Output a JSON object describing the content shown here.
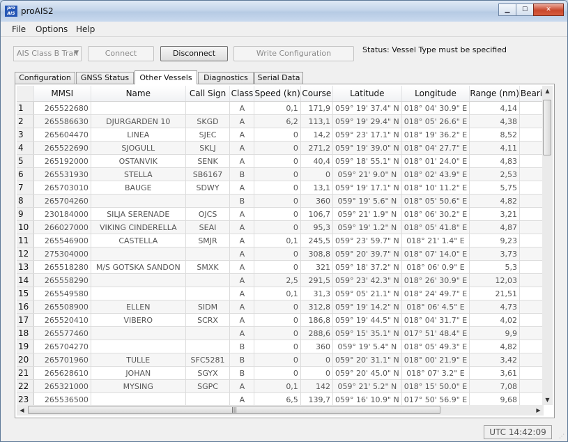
{
  "window": {
    "title": "proAIS2",
    "icon_text": "pro AIS"
  },
  "menu": [
    "File",
    "Options",
    "Help"
  ],
  "toolbar": {
    "device_select": "AIS Class B Tran",
    "connect_label": "Connect",
    "disconnect_label": "Disconnect",
    "write_config_label": "Write Configuration",
    "status_text": "Status: Vessel Type must be specified"
  },
  "tabs": [
    "Configuration",
    "GNSS Status",
    "Other Vessels",
    "Diagnostics",
    "Serial Data"
  ],
  "selected_tab": "Other Vessels",
  "table": {
    "columns": [
      "",
      "MMSI",
      "Name",
      "Call Sign",
      "Class",
      "Speed (kn)",
      "Course",
      "Latitude",
      "Longitude",
      "Range (nm)",
      "Beari"
    ],
    "rows": [
      [
        "1",
        "265522680",
        "",
        "",
        "A",
        "0,1",
        "171,9",
        "059° 19' 37.4\" N",
        "018° 04' 30.9\" E",
        "4,14",
        ""
      ],
      [
        "2",
        "265586630",
        "DJURGARDEN 10",
        "SKGD",
        "A",
        "6,2",
        "113,1",
        "059° 19' 29.4\" N",
        "018° 05' 26.6\" E",
        "4,38",
        ""
      ],
      [
        "3",
        "265604470",
        "LINEA",
        "SJEC",
        "A",
        "0",
        "14,2",
        "059° 23' 17.1\" N",
        "018° 19' 36.2\" E",
        "8,52",
        ""
      ],
      [
        "4",
        "265522690",
        "SJOGULL",
        "SKLJ",
        "A",
        "0",
        "271,2",
        "059° 19' 39.0\" N",
        "018° 04' 27.7\" E",
        "4,11",
        ""
      ],
      [
        "5",
        "265192000",
        "OSTANVIK",
        "SENK",
        "A",
        "0",
        "40,4",
        "059° 18' 55.1\" N",
        "018° 01' 24.0\" E",
        "4,83",
        ""
      ],
      [
        "6",
        "265531930",
        "STELLA",
        "SB6167",
        "B",
        "0",
        "0",
        "059° 21' 9.0\" N",
        "018° 02' 43.9\" E",
        "2,53",
        ""
      ],
      [
        "7",
        "265703010",
        "BAUGE",
        "SDWY",
        "A",
        "0",
        "13,1",
        "059° 19' 17.1\" N",
        "018° 10' 11.2\" E",
        "5,75",
        ""
      ],
      [
        "8",
        "265704260",
        "",
        "",
        "B",
        "0",
        "360",
        "059° 19' 5.6\" N",
        "018° 05' 50.6\" E",
        "4,82",
        ""
      ],
      [
        "9",
        "230184000",
        "SILJA SERENADE",
        "OJCS",
        "A",
        "0",
        "106,7",
        "059° 21' 1.9\" N",
        "018° 06' 30.2\" E",
        "3,21",
        ""
      ],
      [
        "10",
        "266027000",
        "VIKING CINDERELLA",
        "SEAI",
        "A",
        "0",
        "95,3",
        "059° 19' 1.2\" N",
        "018° 05' 41.8\" E",
        "4,87",
        ""
      ],
      [
        "11",
        "265546900",
        "CASTELLA",
        "SMJR",
        "A",
        "0,1",
        "245,5",
        "059° 23' 59.7\" N",
        "018° 21' 1.4\" E",
        "9,23",
        ""
      ],
      [
        "12",
        "275304000",
        "",
        "",
        "A",
        "0",
        "308,8",
        "059° 20' 39.7\" N",
        "018° 07' 14.0\" E",
        "3,73",
        ""
      ],
      [
        "13",
        "265518280",
        "M/S GOTSKA SANDON",
        "SMXK",
        "A",
        "0",
        "321",
        "059° 18' 37.2\" N",
        "018° 06' 0.9\" E",
        "5,3",
        ""
      ],
      [
        "14",
        "265558290",
        "",
        "",
        "A",
        "2,5",
        "291,5",
        "059° 23' 42.3\" N",
        "018° 26' 30.9\" E",
        "12,03",
        ""
      ],
      [
        "15",
        "265549580",
        "",
        "",
        "A",
        "0,1",
        "31,3",
        "059° 05' 21.1\" N",
        "018° 24' 49.7\" E",
        "21,51",
        ""
      ],
      [
        "16",
        "265508900",
        "ELLEN",
        "SIDM",
        "A",
        "0",
        "312,8",
        "059° 19' 14.2\" N",
        "018° 06' 4.5\" E",
        "4,73",
        ""
      ],
      [
        "17",
        "265520410",
        "VIBERO",
        "SCRX",
        "A",
        "0",
        "186,8",
        "059° 19' 44.5\" N",
        "018° 04' 31.7\" E",
        "4,02",
        ""
      ],
      [
        "18",
        "265577460",
        "",
        "",
        "A",
        "0",
        "288,6",
        "059° 15' 35.1\" N",
        "017° 51' 48.4\" E",
        "9,9",
        ""
      ],
      [
        "19",
        "265704270",
        "",
        "",
        "B",
        "0",
        "360",
        "059° 19' 5.4\" N",
        "018° 05' 49.3\" E",
        "4,82",
        ""
      ],
      [
        "20",
        "265701960",
        "TULLE",
        "SFC5281",
        "B",
        "0",
        "0",
        "059° 20' 31.1\" N",
        "018° 00' 21.9\" E",
        "3,42",
        ""
      ],
      [
        "21",
        "265628610",
        "JOHAN",
        "SGYX",
        "B",
        "0",
        "0",
        "059° 20' 45.0\" N",
        "018° 07' 3.2\" E",
        "3,61",
        ""
      ],
      [
        "22",
        "265321000",
        "MYSING",
        "SGPC",
        "A",
        "0,1",
        "142",
        "059° 21' 5.2\" N",
        "018° 15' 50.0\" E",
        "7,08",
        ""
      ],
      [
        "23",
        "265536500",
        "",
        "",
        "A",
        "6,5",
        "139,7",
        "059° 16' 10.9\" N",
        "017° 50' 56.9\" E",
        "9,68",
        ""
      ]
    ]
  },
  "statusbar": {
    "clock": "UTC  14:42:09"
  }
}
